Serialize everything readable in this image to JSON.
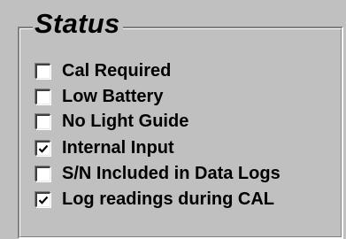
{
  "status_group": {
    "title": "Status",
    "options": [
      {
        "label": "Cal Required",
        "checked": false
      },
      {
        "label": "Low Battery",
        "checked": false
      },
      {
        "label": "No Light Guide",
        "checked": false
      },
      {
        "label": "Internal Input",
        "checked": true
      },
      {
        "label": "S/N Included in Data Logs",
        "checked": false
      },
      {
        "label": "Log readings during CAL",
        "checked": true
      }
    ]
  },
  "colors": {
    "face": "#c0c0c0",
    "check_mark": "#000000"
  }
}
